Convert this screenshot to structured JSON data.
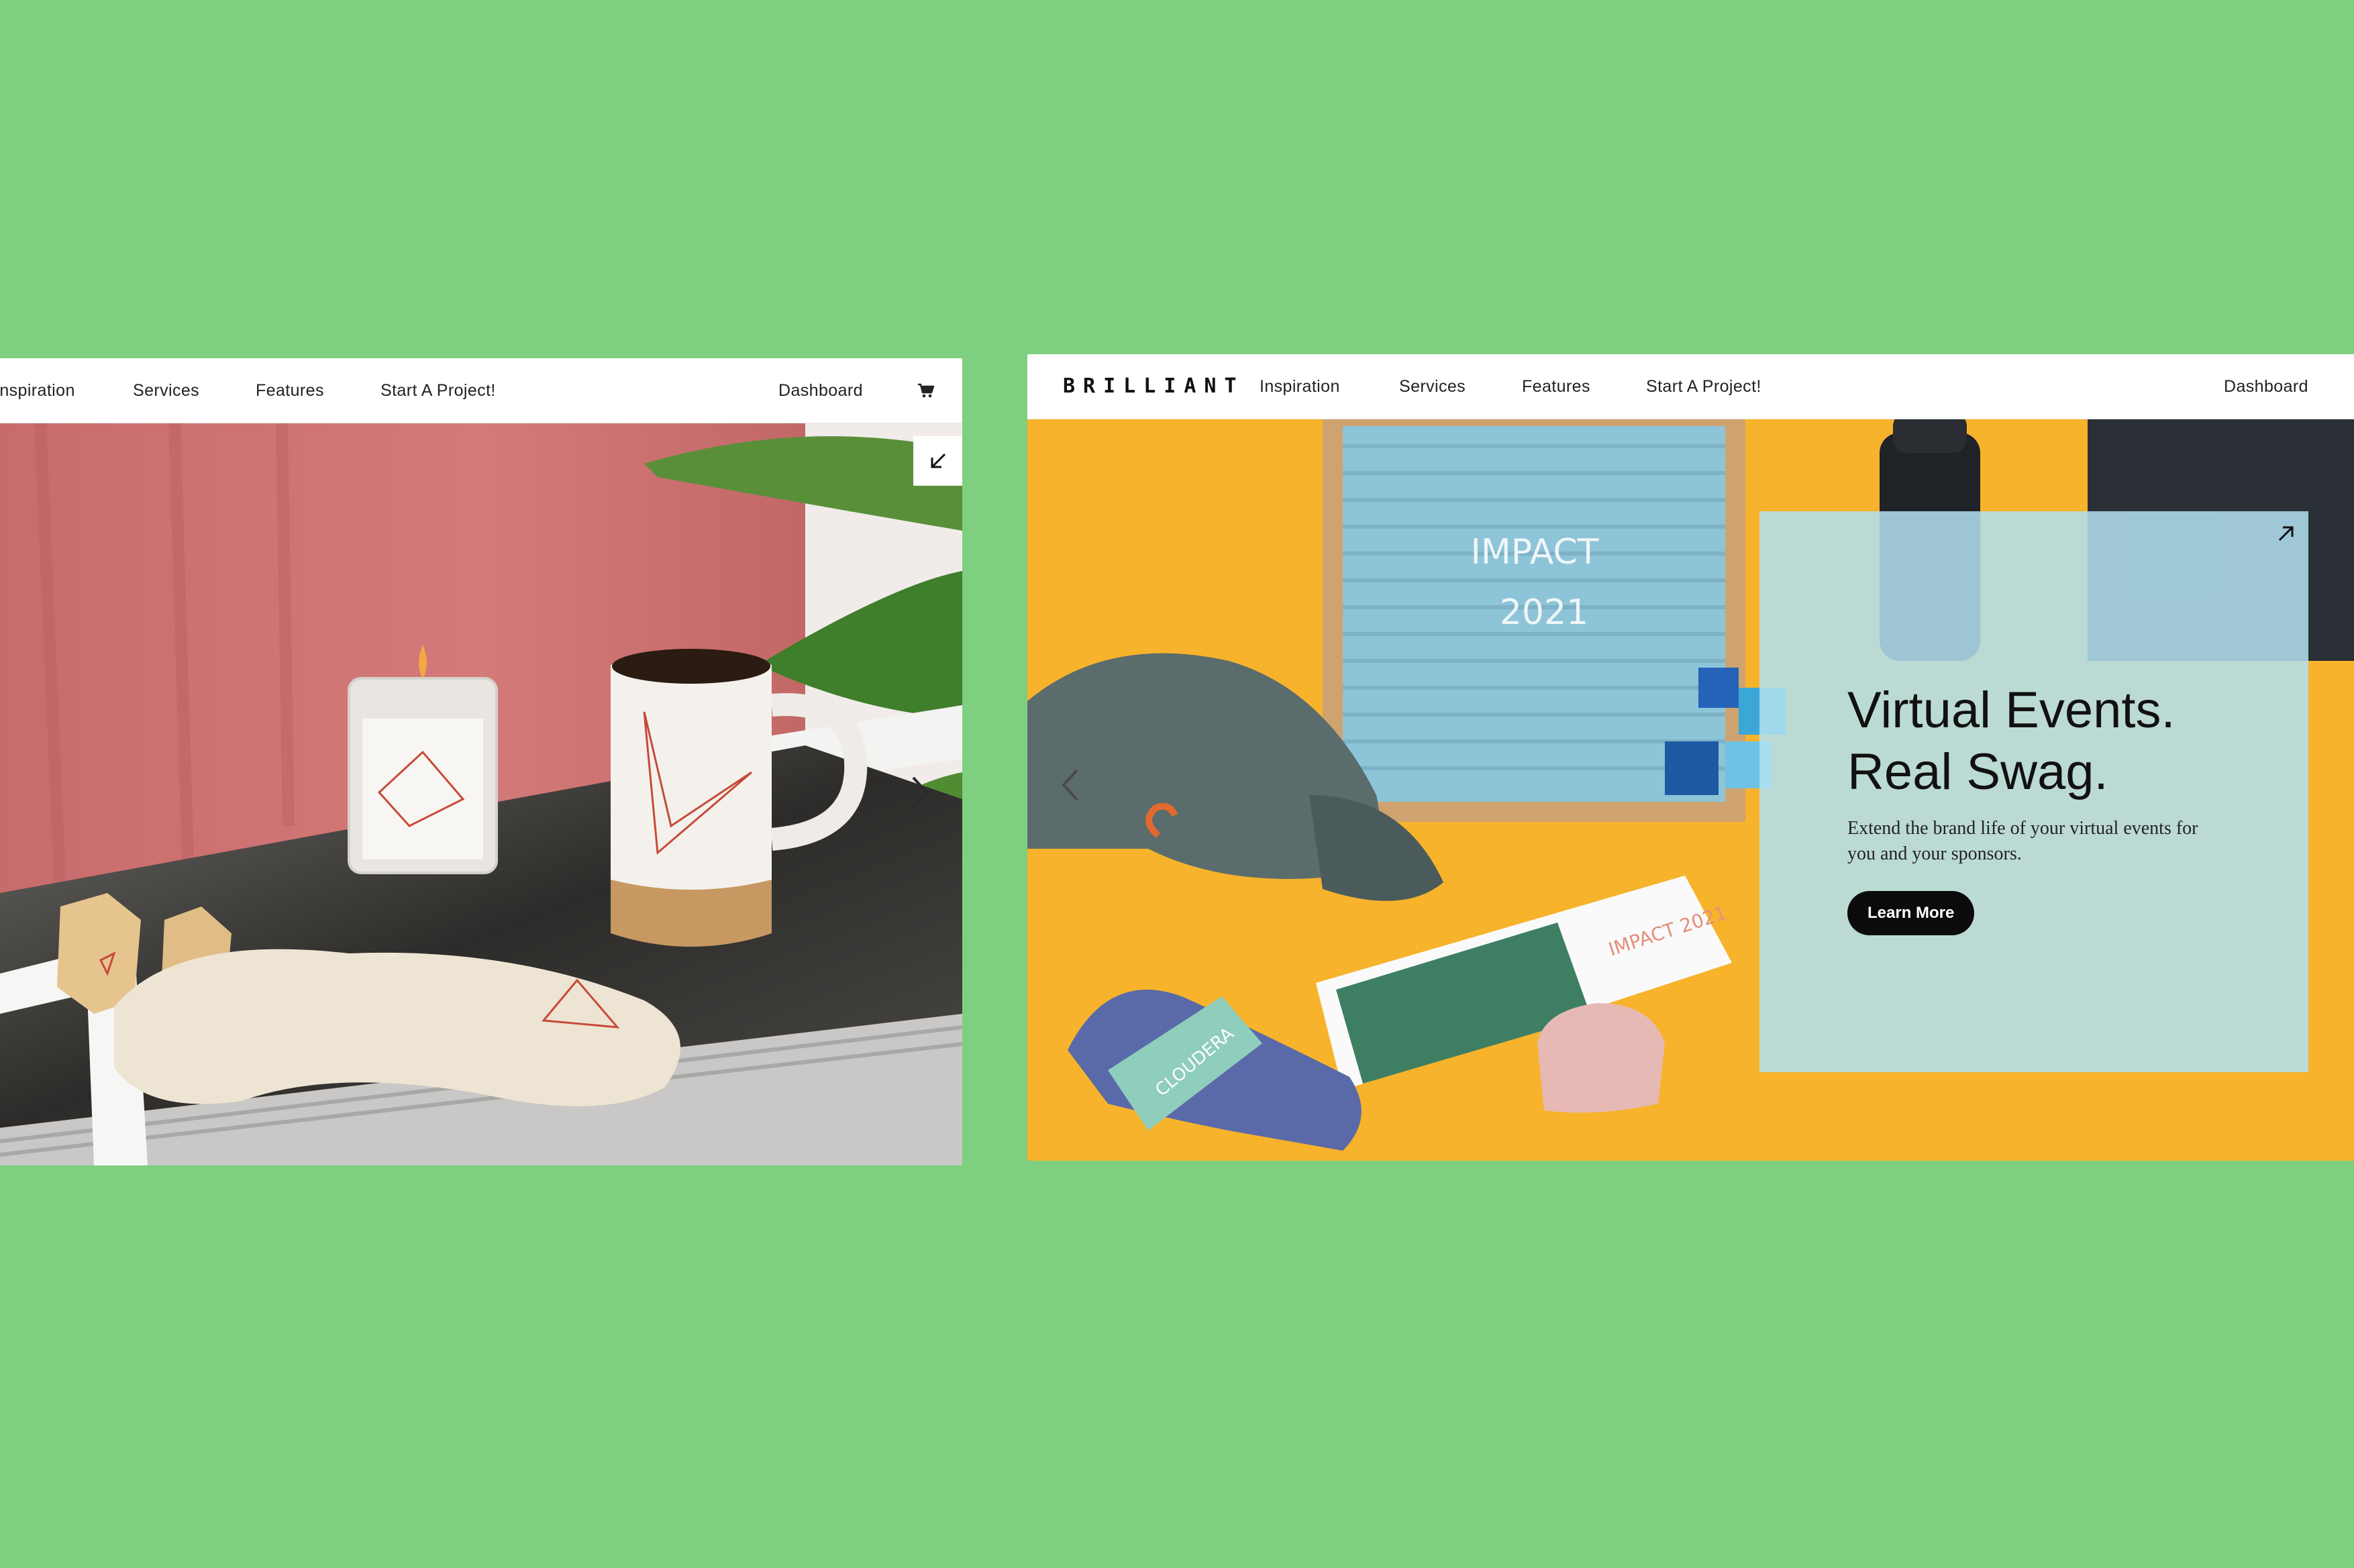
{
  "colors": {
    "background": "#7ecf80",
    "nav_background": "#ffffff",
    "left_wall": "#cf6f6e",
    "right_backdrop": "#f7b32b",
    "overlay": "#b2e1f0",
    "button": "#0b0b0b"
  },
  "left_panel": {
    "nav": {
      "items": [
        "Inspiration",
        "Services",
        "Features",
        "Start A Project!"
      ],
      "dashboard": "Dashboard",
      "cart_icon": "cart-icon"
    },
    "corner_icon": "arrow-down-left-icon",
    "next_icon": "chevron-right-icon"
  },
  "right_panel": {
    "nav": {
      "brand": "BRILLIANT",
      "items": [
        "Inspiration",
        "Services",
        "Features",
        "Start A Project!"
      ],
      "dashboard": "Dashboard"
    },
    "prev_icon": "chevron-left-icon",
    "overlay": {
      "title_line1": "Virtual Events.",
      "title_line2": "Real Swag.",
      "description": "Extend the brand life of your virtual events for you and your sponsors.",
      "button": "Learn More",
      "corner_icon": "arrow-up-right-icon"
    }
  }
}
